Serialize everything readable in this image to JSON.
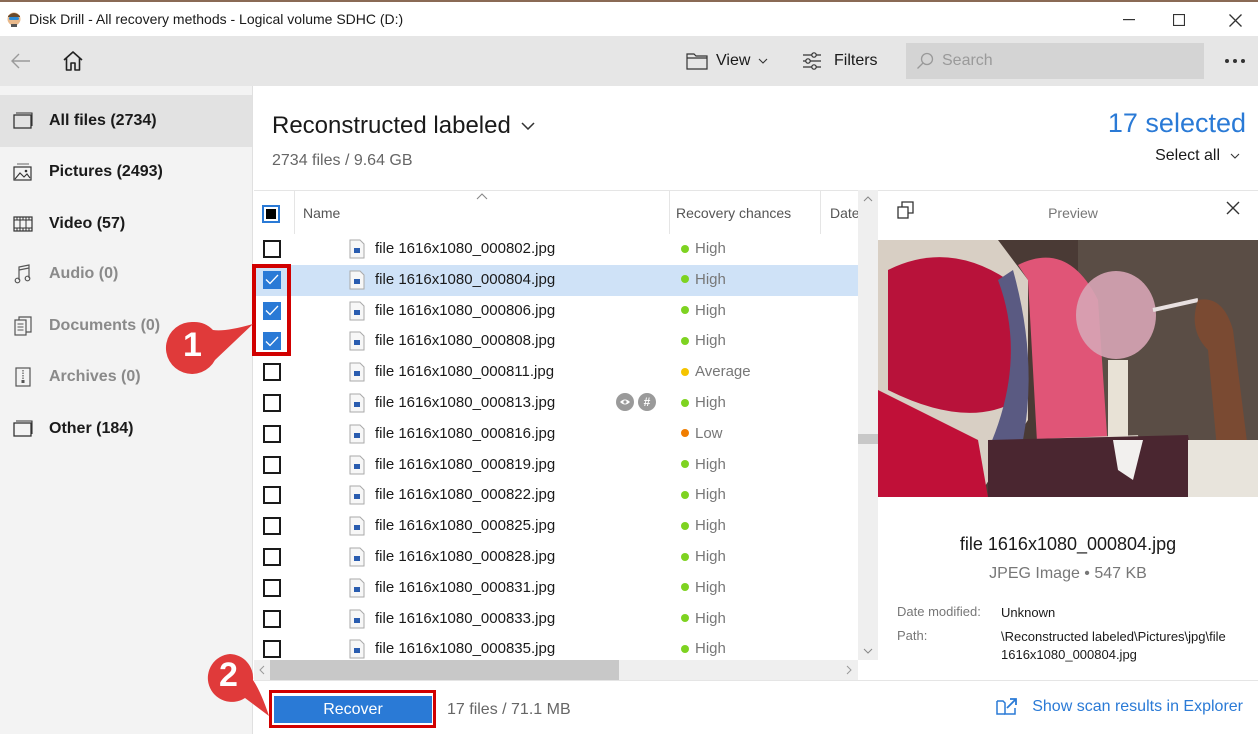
{
  "window": {
    "title": "Disk Drill - All recovery methods - Logical volume SDHC (D:)",
    "app_icon": "disk-drill-logo-icon",
    "controls": [
      "minimize-icon",
      "maximize-icon",
      "close-icon"
    ]
  },
  "toolbar": {
    "back_icon": "arrow-left-icon",
    "home_icon": "home-icon",
    "view_label": "View",
    "filters_label": "Filters",
    "search_placeholder": "Search",
    "more_icon": "more-horizontal-icon"
  },
  "sidebar": {
    "items": [
      {
        "label": "All files (2734)",
        "icon": "all-files-icon",
        "active": true,
        "enabled": true
      },
      {
        "label": "Pictures (2493)",
        "icon": "pictures-icon",
        "active": false,
        "enabled": true
      },
      {
        "label": "Video (57)",
        "icon": "video-icon",
        "active": false,
        "enabled": true
      },
      {
        "label": "Audio (0)",
        "icon": "audio-icon",
        "active": false,
        "enabled": false
      },
      {
        "label": "Documents (0)",
        "icon": "documents-icon",
        "active": false,
        "enabled": false
      },
      {
        "label": "Archives (0)",
        "icon": "archives-icon",
        "active": false,
        "enabled": false
      },
      {
        "label": "Other (184)",
        "icon": "other-icon",
        "active": false,
        "enabled": true
      }
    ]
  },
  "main": {
    "title": "Reconstructed labeled",
    "subtitle": "2734 files / 9.64 GB",
    "selected_count": "17 selected",
    "select_all_label": "Select all",
    "columns": {
      "name": "Name",
      "recovery": "Recovery chances",
      "date": "Date"
    },
    "rows": [
      {
        "name": "file 1616x1080_000802.jpg",
        "chance": "High",
        "checked": false,
        "highlighted": false
      },
      {
        "name": "file 1616x1080_000804.jpg",
        "chance": "High",
        "checked": true,
        "highlighted": true
      },
      {
        "name": "file 1616x1080_000806.jpg",
        "chance": "High",
        "checked": true,
        "highlighted": false
      },
      {
        "name": "file 1616x1080_000808.jpg",
        "chance": "High",
        "checked": true,
        "highlighted": false
      },
      {
        "name": "file 1616x1080_000811.jpg",
        "chance": "Average",
        "checked": false,
        "highlighted": false
      },
      {
        "name": "file 1616x1080_000813.jpg",
        "chance": "High",
        "checked": false,
        "highlighted": false,
        "hover_actions": true
      },
      {
        "name": "file 1616x1080_000816.jpg",
        "chance": "Low",
        "checked": false,
        "highlighted": false
      },
      {
        "name": "file 1616x1080_000819.jpg",
        "chance": "High",
        "checked": false,
        "highlighted": false
      },
      {
        "name": "file 1616x1080_000822.jpg",
        "chance": "High",
        "checked": false,
        "highlighted": false
      },
      {
        "name": "file 1616x1080_000825.jpg",
        "chance": "High",
        "checked": false,
        "highlighted": false
      },
      {
        "name": "file 1616x1080_000828.jpg",
        "chance": "High",
        "checked": false,
        "highlighted": false
      },
      {
        "name": "file 1616x1080_000831.jpg",
        "chance": "High",
        "checked": false,
        "highlighted": false
      },
      {
        "name": "file 1616x1080_000833.jpg",
        "chance": "High",
        "checked": false,
        "highlighted": false
      },
      {
        "name": "file 1616x1080_000835.jpg",
        "chance": "High",
        "checked": false,
        "highlighted": false
      }
    ],
    "chance_colors": {
      "High": "#7ed321",
      "Average": "#f5c400",
      "Low": "#f07d00"
    }
  },
  "preview": {
    "title": "Preview",
    "file_name": "file 1616x1080_000804.jpg",
    "file_type": "JPEG Image • 547 KB",
    "date_label": "Date modified:",
    "date_value": "Unknown",
    "path_label": "Path:",
    "path_value": "\\Reconstructed labeled\\Pictures\\jpg\\file 1616x1080_000804.jpg"
  },
  "footer": {
    "recover_label": "Recover",
    "summary": "17 files / 71.1 MB",
    "explorer_link": "Show scan results in Explorer"
  },
  "annotations": {
    "step1": "1",
    "step2": "2",
    "color": "#d10000"
  },
  "colors": {
    "accent": "#2a7ad6",
    "selected_row": "#cfe2f7",
    "annotation_red": "#d10000"
  }
}
